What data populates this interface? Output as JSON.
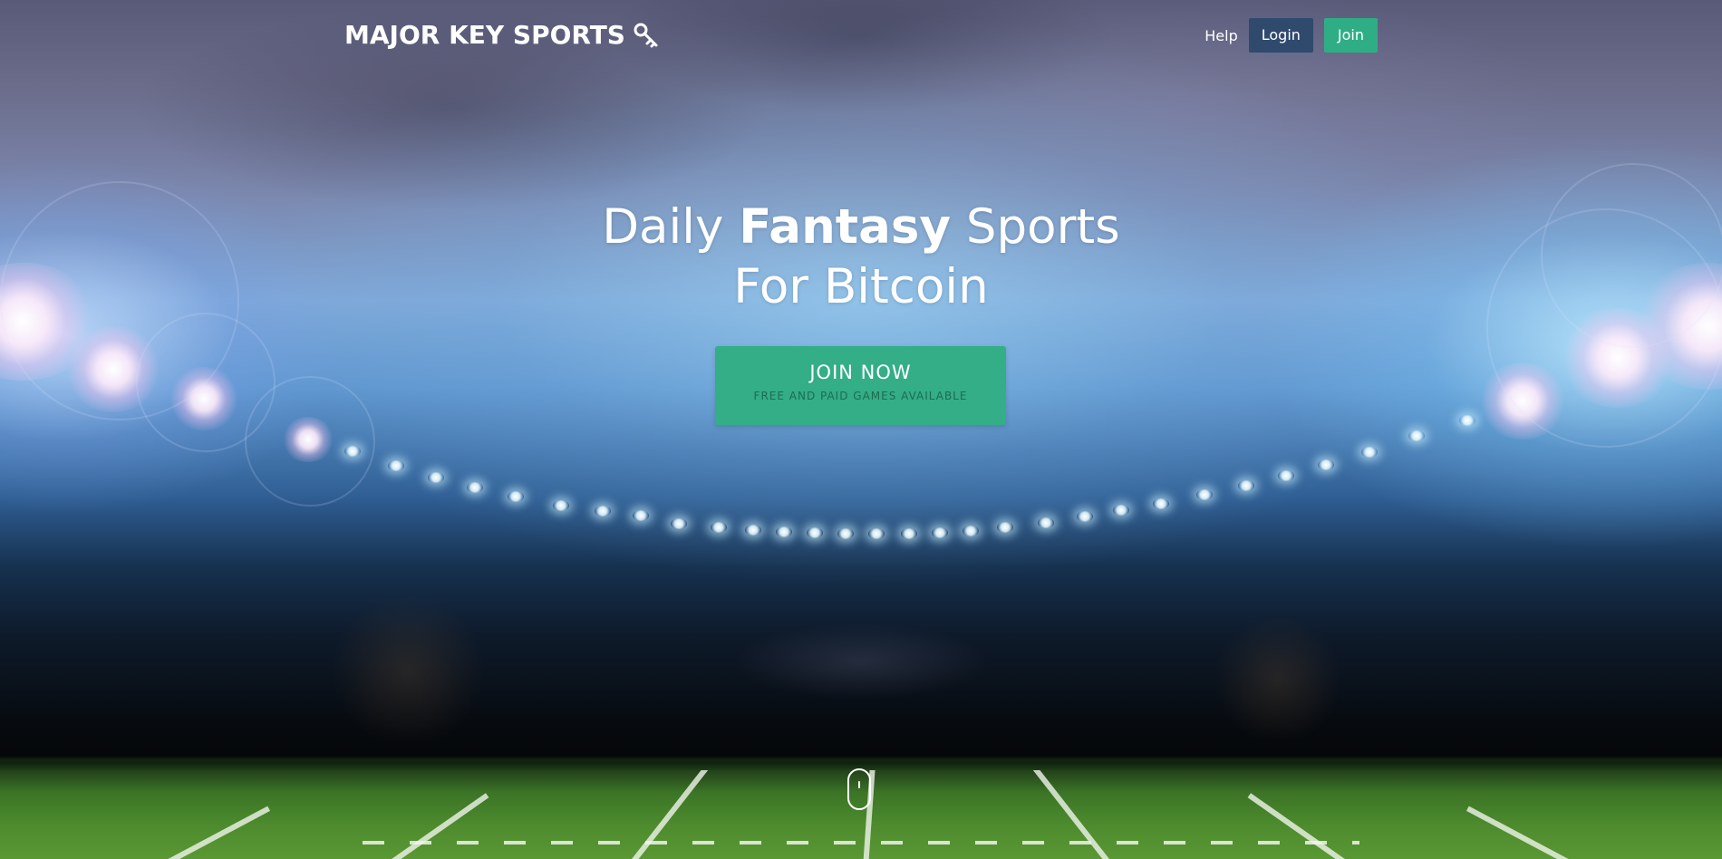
{
  "navbar": {
    "brand": "MAJOR KEY SPORTS",
    "brand_icon": "key-icon",
    "help_label": "Help",
    "login_label": "Login",
    "join_label": "Join"
  },
  "hero": {
    "title_part1": "Daily",
    "title_bold": "Fantasy",
    "title_part2": "Sports",
    "title_line2": "For Bitcoin",
    "cta_label": "JOIN NOW",
    "cta_sublabel": "FREE AND PAID GAMES AVAILABLE",
    "scroll_icon": "mouse-scroll-icon"
  },
  "colors": {
    "login_button": "#2f4a6d",
    "join_button": "#2fae86",
    "cta_button": "#33ae86",
    "cta_sublabel": "#1f6b51"
  }
}
